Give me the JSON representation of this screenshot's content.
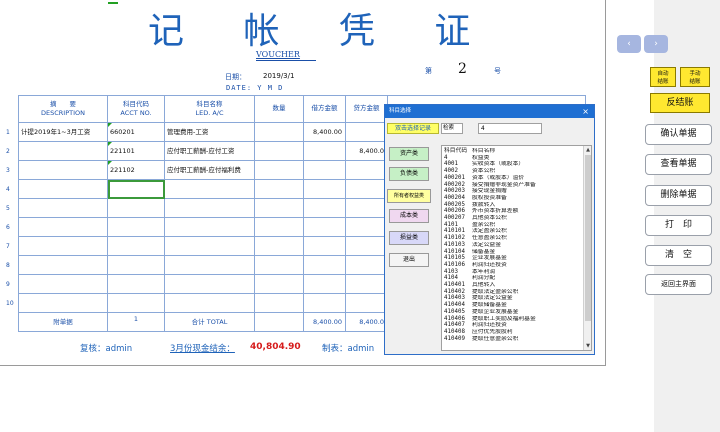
{
  "voucher": {
    "title": "记 帐 凭 证",
    "title_en": "VOUCHER",
    "date_label": "日期：",
    "date_value": "2019/3/1",
    "date_en": "DATE: Y   M   D",
    "no_label": "第",
    "no_value": "2",
    "no_suffix": "号"
  },
  "table": {
    "headers": [
      {
        "cn": "摘　　要",
        "en": "DESCRIPTION"
      },
      {
        "cn": "科目代码",
        "en": "ACCT NO."
      },
      {
        "cn": "科目名称",
        "en": "LED. A/C"
      },
      {
        "cn": "数量",
        "en": ""
      },
      {
        "cn": "借方金额",
        "en": ""
      },
      {
        "cn": "贷方金额",
        "en": ""
      }
    ],
    "row_numbers": [
      "1",
      "2",
      "3",
      "4",
      "5",
      "6",
      "7",
      "8",
      "9",
      "10"
    ],
    "rows": [
      {
        "desc": "计提2019年1~3月工资",
        "code": "660201",
        "name": "管理费用-工资",
        "qty": "",
        "debit": "8,400.00",
        "credit": ""
      },
      {
        "desc": "",
        "code": "221101",
        "name": "应付职工薪酬-应付工资",
        "qty": "",
        "debit": "",
        "credit": "8,400.0"
      },
      {
        "desc": "",
        "code": "221102",
        "name": "应付职工薪酬-应付福利费",
        "qty": "",
        "debit": "",
        "credit": ""
      },
      {
        "desc": "",
        "code": "",
        "name": "",
        "qty": "",
        "debit": "",
        "credit": ""
      },
      {
        "desc": "",
        "code": "",
        "name": "",
        "qty": "",
        "debit": "",
        "credit": ""
      },
      {
        "desc": "",
        "code": "",
        "name": "",
        "qty": "",
        "debit": "",
        "credit": ""
      },
      {
        "desc": "",
        "code": "",
        "name": "",
        "qty": "",
        "debit": "",
        "credit": ""
      },
      {
        "desc": "",
        "code": "",
        "name": "",
        "qty": "",
        "debit": "",
        "credit": ""
      },
      {
        "desc": "",
        "code": "",
        "name": "",
        "qty": "",
        "debit": "",
        "credit": ""
      },
      {
        "desc": "",
        "code": "",
        "name": "",
        "qty": "",
        "debit": "",
        "credit": ""
      }
    ],
    "total": {
      "attach": "附单据",
      "attach_count": "1",
      "label": "合计  TOTAL",
      "debit": "8,400.00",
      "credit": "8,400.0"
    }
  },
  "footer": {
    "reviewer": "复核：admin",
    "cash_label": "3月份现金结余：",
    "cash_value": "40,804.90",
    "maker": "制表：admin"
  },
  "dialog": {
    "title": "科目选择",
    "close": "×",
    "hint": "双击选择记录",
    "search_label": "检索",
    "search_value": "4",
    "buttons": [
      "资产类",
      "负债类",
      "所有者权益类",
      "成本类",
      "损益类",
      "退出"
    ],
    "button_colors": [
      "#c6f0c6",
      "#c6f0c6",
      "#ffffa0",
      "#f0d8f0",
      "#d8d8f8",
      "#f4f4f4"
    ],
    "list": [
      {
        "code": "科目代码",
        "name": "科目名称"
      },
      {
        "code": "4",
        "name": "权益类"
      },
      {
        "code": "4001",
        "name": "实收资本（或股本）"
      },
      {
        "code": "4002",
        "name": "资本公积"
      },
      {
        "code": "400201",
        "name": "资本（或股本）溢价"
      },
      {
        "code": "400202",
        "name": "接受捐赠非现金资产准备"
      },
      {
        "code": "400203",
        "name": "接受现金捐赠"
      },
      {
        "code": "400204",
        "name": "股权投资准备"
      },
      {
        "code": "400205",
        "name": "拨款转入"
      },
      {
        "code": "400206",
        "name": "外币资本折算差额"
      },
      {
        "code": "400207",
        "name": "其他资本公积"
      },
      {
        "code": "4101",
        "name": "盈余公积"
      },
      {
        "code": "410101",
        "name": "法定盈余公积"
      },
      {
        "code": "410102",
        "name": "任意盈余公积"
      },
      {
        "code": "410103",
        "name": "法定公益金"
      },
      {
        "code": "410104",
        "name": "储备基金"
      },
      {
        "code": "410105",
        "name": "企业发展基金"
      },
      {
        "code": "410106",
        "name": "利润归还投资"
      },
      {
        "code": "4103",
        "name": "本年利润"
      },
      {
        "code": "4104",
        "name": "利润分配"
      },
      {
        "code": "410401",
        "name": "其他转入"
      },
      {
        "code": "410402",
        "name": "提取法定盈余公积"
      },
      {
        "code": "410403",
        "name": "提取法定公益金"
      },
      {
        "code": "410404",
        "name": "提取储备基金"
      },
      {
        "code": "410405",
        "name": "提取企业发展基金"
      },
      {
        "code": "410406",
        "name": "提取职工奖励及福利基金"
      },
      {
        "code": "410407",
        "name": "利润归还投资"
      },
      {
        "code": "410408",
        "name": "应付优先股股利"
      },
      {
        "code": "410409",
        "name": "提取任意盈余公积"
      }
    ]
  },
  "right_panel": {
    "prev": "‹",
    "next": "›",
    "auto_settle": "自动\n结账",
    "manual_settle": "手动\n结账",
    "reverse_settle": "反结账",
    "buttons": [
      "确认单据",
      "查看单据",
      "删除单据",
      "打　印",
      "清　空",
      "返回主界面"
    ]
  }
}
